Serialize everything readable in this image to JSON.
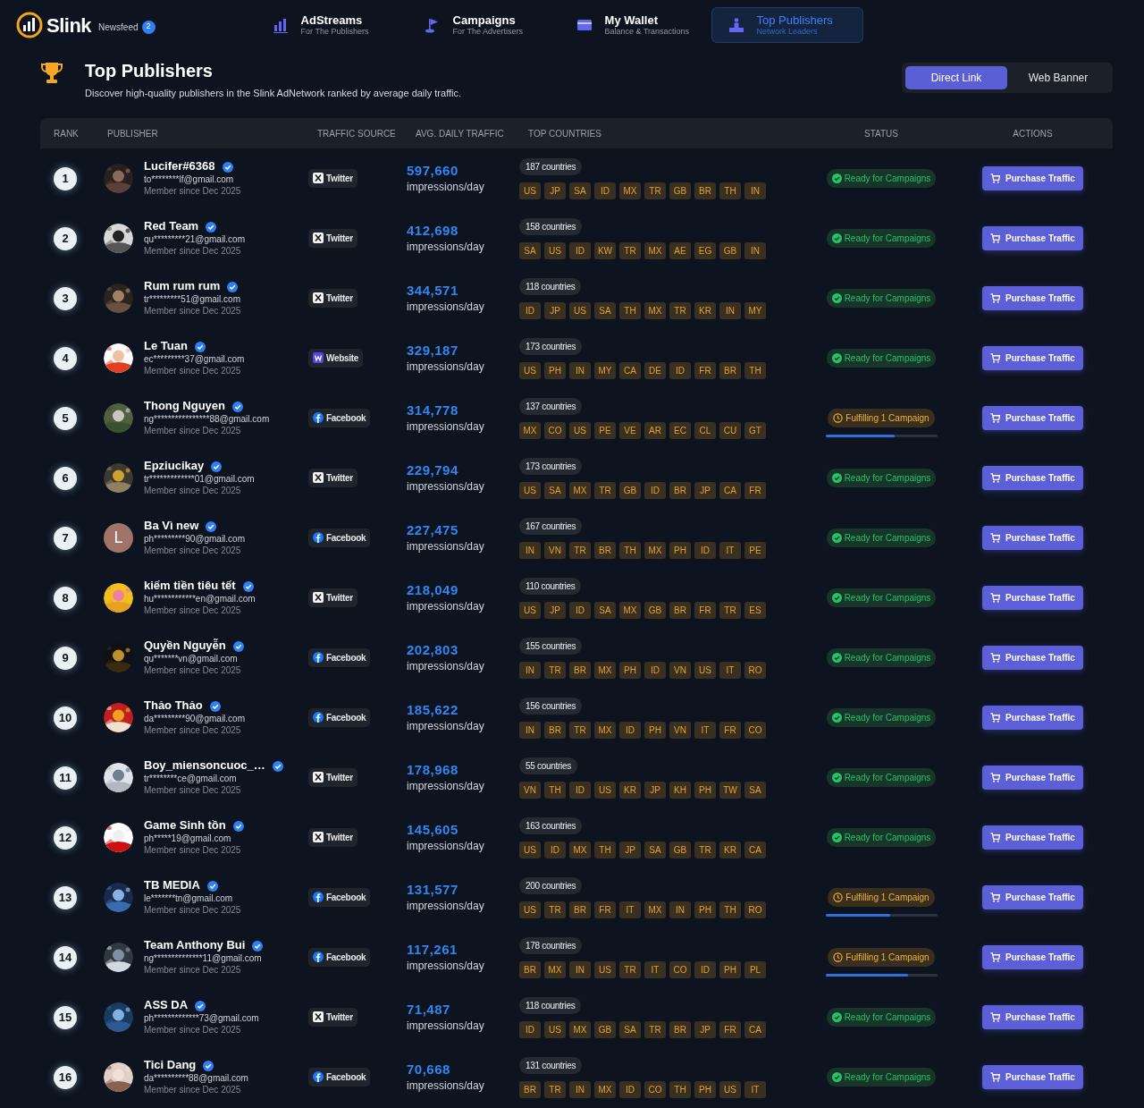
{
  "brand": {
    "name": "Slink",
    "newsfeed": "Newsfeed",
    "badge": "2"
  },
  "nav": [
    {
      "kind": "chart",
      "title": "AdStreams",
      "subtitle": "For The Publishers",
      "selected": false
    },
    {
      "kind": "flag",
      "title": "Campaigns",
      "subtitle": "For The Advertisers",
      "selected": false
    },
    {
      "kind": "wallet",
      "title": "My Wallet",
      "subtitle": "Balance & Transactions",
      "selected": false
    },
    {
      "kind": "podium",
      "title": "Top Publishers",
      "subtitle": "Network Leaders",
      "selected": true
    }
  ],
  "page": {
    "title": "Top Publishers",
    "subtitle": "Discover high-quality publishers in the Slink AdNetwork ranked by average daily traffic."
  },
  "toggle": [
    {
      "label": "Direct Link",
      "selected": true
    },
    {
      "label": "Web Banner",
      "selected": false
    }
  ],
  "table": {
    "columns": [
      "RANK",
      "PUBLISHER",
      "TRAFFIC SOURCE",
      "AVG. DAILY TRAFFIC",
      "TOP COUNTRIES",
      "STATUS",
      "ACTIONS"
    ],
    "rows": [
      {
        "rank": "1",
        "name": "Lucifer#6368",
        "email": "to********lf@gmail.com",
        "since": "Member since Dec 2025",
        "source": {
          "kind": "twitter",
          "label": "Twitter"
        },
        "traffic": "597,660",
        "unit": "impressions/day",
        "countries_count": "187 countries",
        "countries": [
          "US",
          "JP",
          "SA",
          "ID",
          "MX",
          "TR",
          "GB",
          "BR",
          "TH",
          "IN"
        ],
        "status": {
          "kind": "ready",
          "label": "Ready for Campaigns"
        },
        "action": "Purchase Traffic"
      },
      {
        "rank": "2",
        "name": "Red Team",
        "email": "qu*********21@gmail.com",
        "since": "Member since Dec 2025",
        "source": {
          "kind": "twitter",
          "label": "Twitter"
        },
        "traffic": "412,698",
        "unit": "impressions/day",
        "countries_count": "158 countries",
        "countries": [
          "SA",
          "US",
          "ID",
          "KW",
          "TR",
          "MX",
          "AE",
          "EG",
          "GB",
          "IN"
        ],
        "status": {
          "kind": "ready",
          "label": "Ready for Campaigns"
        },
        "action": "Purchase Traffic"
      },
      {
        "rank": "3",
        "name": "Rum rum rum",
        "email": "tr*********51@gmail.com",
        "since": "Member since Dec 2025",
        "source": {
          "kind": "twitter",
          "label": "Twitter"
        },
        "traffic": "344,571",
        "unit": "impressions/day",
        "countries_count": "118 countries",
        "countries": [
          "ID",
          "JP",
          "US",
          "SA",
          "TH",
          "MX",
          "TR",
          "KR",
          "IN",
          "MY"
        ],
        "status": {
          "kind": "ready",
          "label": "Ready for Campaigns"
        },
        "action": "Purchase Traffic"
      },
      {
        "rank": "4",
        "name": "Le Tuan",
        "email": "ec*********37@gmail.com",
        "since": "Member since Dec 2025",
        "source": {
          "kind": "website",
          "label": "Website"
        },
        "traffic": "329,187",
        "unit": "impressions/day",
        "countries_count": "173 countries",
        "countries": [
          "US",
          "PH",
          "IN",
          "MY",
          "CA",
          "DE",
          "ID",
          "FR",
          "BR",
          "TH"
        ],
        "status": {
          "kind": "ready",
          "label": "Ready for Campaigns"
        },
        "action": "Purchase Traffic"
      },
      {
        "rank": "5",
        "name": "Thong Nguyen",
        "email": "ng****************88@gmail.com",
        "since": "Member since Dec 2025",
        "source": {
          "kind": "facebook",
          "label": "Facebook"
        },
        "traffic": "314,778",
        "unit": "impressions/day",
        "countries_count": "137 countries",
        "countries": [
          "MX",
          "CO",
          "US",
          "PE",
          "VE",
          "AR",
          "EC",
          "CL",
          "CU",
          "GT"
        ],
        "status": {
          "kind": "fulfilling",
          "label": "Fulfilling 1 Campaign",
          "level": 0.62
        },
        "action": "Purchase Traffic"
      },
      {
        "rank": "6",
        "name": "Epziucikay",
        "email": "tr*************01@gmail.com",
        "since": "Member since Dec 2025",
        "source": {
          "kind": "twitter",
          "label": "Twitter"
        },
        "traffic": "229,794",
        "unit": "impressions/day",
        "countries_count": "173 countries",
        "countries": [
          "US",
          "SA",
          "MX",
          "TR",
          "GB",
          "ID",
          "BR",
          "JP",
          "CA",
          "FR"
        ],
        "status": {
          "kind": "ready",
          "label": "Ready for Campaigns"
        },
        "action": "Purchase Traffic"
      },
      {
        "rank": "7",
        "avatar": {
          "kind": "initial",
          "text": "L"
        },
        "name": "Ba Vì new",
        "email": "ph*********90@gmail.com",
        "since": "Member since Dec 2025",
        "source": {
          "kind": "facebook",
          "label": "Facebook"
        },
        "traffic": "227,475",
        "unit": "impressions/day",
        "countries_count": "167 countries",
        "countries": [
          "IN",
          "VN",
          "TR",
          "BR",
          "TH",
          "MX",
          "PH",
          "ID",
          "IT",
          "PE"
        ],
        "status": {
          "kind": "ready",
          "label": "Ready for Campaigns"
        },
        "action": "Purchase Traffic"
      },
      {
        "rank": "8",
        "name": "kiếm tiền tiêu tết",
        "email": "hu************en@gmail.com",
        "since": "Member since Dec 2025",
        "source": {
          "kind": "twitter",
          "label": "Twitter"
        },
        "traffic": "218,049",
        "unit": "impressions/day",
        "countries_count": "110 countries",
        "countries": [
          "US",
          "JP",
          "ID",
          "SA",
          "MX",
          "GB",
          "BR",
          "FR",
          "TR",
          "ES"
        ],
        "status": {
          "kind": "ready",
          "label": "Ready for Campaigns"
        },
        "action": "Purchase Traffic"
      },
      {
        "rank": "9",
        "name": "Quyền Nguyễn",
        "email": "qu*******vn@gmail.com",
        "since": "Member since Dec 2025",
        "source": {
          "kind": "facebook",
          "label": "Facebook"
        },
        "traffic": "202,803",
        "unit": "impressions/day",
        "countries_count": "155 countries",
        "countries": [
          "IN",
          "TR",
          "BR",
          "MX",
          "PH",
          "ID",
          "VN",
          "US",
          "IT",
          "RO"
        ],
        "status": {
          "kind": "ready",
          "label": "Ready for Campaigns"
        },
        "action": "Purchase Traffic"
      },
      {
        "rank": "10",
        "name": "Thảo Thảo",
        "email": "da*********90@gmail.com",
        "since": "Member since Dec 2025",
        "source": {
          "kind": "facebook",
          "label": "Facebook"
        },
        "traffic": "185,622",
        "unit": "impressions/day",
        "countries_count": "156 countries",
        "countries": [
          "IN",
          "BR",
          "TR",
          "MX",
          "ID",
          "PH",
          "VN",
          "IT",
          "FR",
          "CO"
        ],
        "status": {
          "kind": "ready",
          "label": "Ready for Campaigns"
        },
        "action": "Purchase Traffic"
      },
      {
        "rank": "11",
        "name": "Boy_miensoncuoc_…",
        "email": "tr********ce@gmail.com",
        "since": "Member since Dec 2025",
        "source": {
          "kind": "twitter",
          "label": "Twitter"
        },
        "traffic": "178,968",
        "unit": "impressions/day",
        "countries_count": "55 countries",
        "countries": [
          "VN",
          "TH",
          "ID",
          "US",
          "KR",
          "JP",
          "KH",
          "PH",
          "TW",
          "SA"
        ],
        "status": {
          "kind": "ready",
          "label": "Ready for Campaigns"
        },
        "action": "Purchase Traffic"
      },
      {
        "rank": "12",
        "name": "Game Sinh tồn",
        "email": "ph*****19@gmail.com",
        "since": "Member since Dec 2025",
        "source": {
          "kind": "twitter",
          "label": "Twitter"
        },
        "traffic": "145,605",
        "unit": "impressions/day",
        "countries_count": "163 countries",
        "countries": [
          "US",
          "ID",
          "MX",
          "TH",
          "JP",
          "SA",
          "GB",
          "TR",
          "KR",
          "CA"
        ],
        "status": {
          "kind": "ready",
          "label": "Ready for Campaigns"
        },
        "action": "Purchase Traffic"
      },
      {
        "rank": "13",
        "name": "TB MEDIA",
        "email": "le*******tn@gmail.com",
        "since": "Member since Dec 2025",
        "source": {
          "kind": "facebook",
          "label": "Facebook"
        },
        "traffic": "131,577",
        "unit": "impressions/day",
        "countries_count": "200 countries",
        "countries": [
          "US",
          "TR",
          "BR",
          "FR",
          "IT",
          "MX",
          "IN",
          "PH",
          "TH",
          "RO"
        ],
        "status": {
          "kind": "fulfilling",
          "label": "Fulfilling 1 Campaign",
          "level": 0.58
        },
        "action": "Purchase Traffic"
      },
      {
        "rank": "14",
        "name": "Team Anthony Bui",
        "email": "ng**************11@gmail.com",
        "since": "Member since Dec 2025",
        "source": {
          "kind": "facebook",
          "label": "Facebook"
        },
        "traffic": "117,261",
        "unit": "impressions/day",
        "countries_count": "178 countries",
        "countries": [
          "BR",
          "MX",
          "IN",
          "US",
          "TR",
          "IT",
          "CO",
          "ID",
          "PH",
          "PL"
        ],
        "status": {
          "kind": "fulfilling",
          "label": "Fulfilling 1 Campaign",
          "level": 0.74
        },
        "action": "Purchase Traffic"
      },
      {
        "rank": "15",
        "name": "ASS DA",
        "email": "ph*************73@gmail.com",
        "since": "Member since Dec 2025",
        "source": {
          "kind": "twitter",
          "label": "Twitter"
        },
        "traffic": "71,487",
        "unit": "impressions/day",
        "countries_count": "118 countries",
        "countries": [
          "ID",
          "US",
          "MX",
          "GB",
          "SA",
          "TR",
          "BR",
          "JP",
          "FR",
          "CA"
        ],
        "status": {
          "kind": "ready",
          "label": "Ready for Campaigns"
        },
        "action": "Purchase Traffic"
      },
      {
        "rank": "16",
        "name": "Tici Dang",
        "email": "da**********88@gmail.com",
        "since": "Member since Dec 2025",
        "source": {
          "kind": "facebook",
          "label": "Facebook"
        },
        "traffic": "70,668",
        "unit": "impressions/day",
        "countries_count": "131 countries",
        "countries": [
          "BR",
          "TR",
          "IN",
          "MX",
          "ID",
          "CO",
          "TH",
          "PH",
          "US",
          "IT"
        ],
        "status": {
          "kind": "ready",
          "label": "Ready for Campaigns"
        },
        "action": "Purchase Traffic"
      }
    ]
  }
}
